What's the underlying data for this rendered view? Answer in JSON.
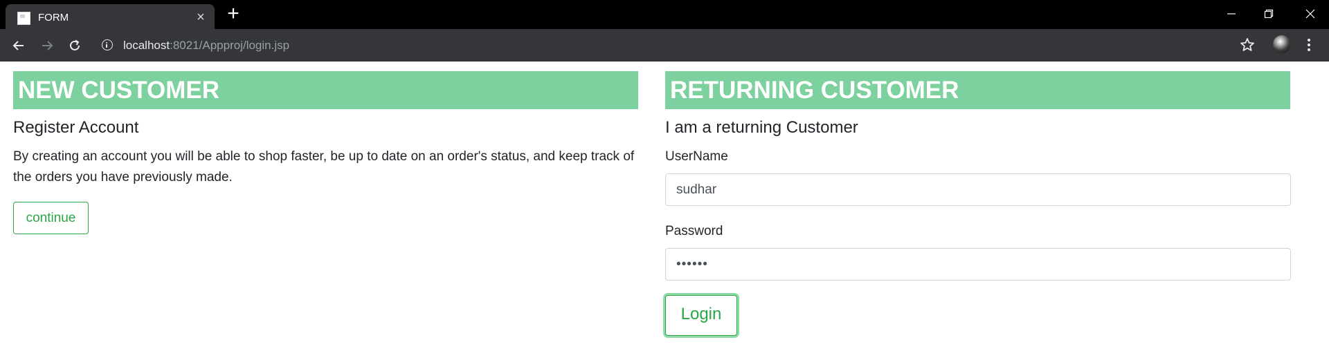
{
  "browser": {
    "tab_title": "FORM",
    "url_host": "localhost",
    "url_rest": ":8021/Appproj/login.jsp"
  },
  "new_customer": {
    "heading": "NEW CUSTOMER",
    "subheading": "Register Account",
    "description": "By creating an account you will be able to shop faster, be up to date on an order's status, and keep track of the orders you have previously made.",
    "continue_label": "continue"
  },
  "returning_customer": {
    "heading": "RETURNING CUSTOMER",
    "subheading": "I am a returning Customer",
    "username_label": "UserName",
    "username_value": "sudhar",
    "password_label": "Password",
    "password_value": "••••••",
    "login_label": "Login"
  },
  "colors": {
    "heading_bg": "#7dd19f",
    "success": "#28a745"
  }
}
